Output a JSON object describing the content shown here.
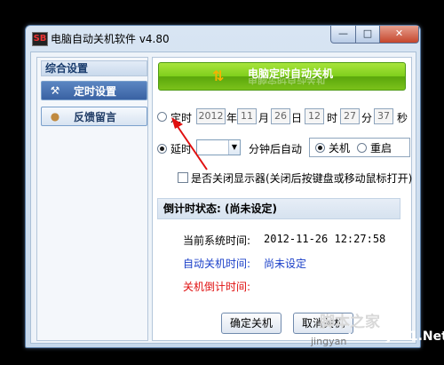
{
  "window": {
    "title": "电脑自动关机软件 v4.80",
    "app_icon_text": "SB",
    "controls": {
      "minimize": "—",
      "maximize": "□",
      "close": "✕"
    }
  },
  "sidebar": {
    "header": "综合设置",
    "items": [
      {
        "label": "定时设置",
        "icon": "tools-icon",
        "active": true
      },
      {
        "label": "反馈留言",
        "icon": "user-icon",
        "active": false
      }
    ]
  },
  "banner": {
    "title": "电脑定时自动关机",
    "icon": "arrows-icon"
  },
  "timed": {
    "label": "定时",
    "year": "2012",
    "year_unit": "年",
    "month": "11",
    "month_unit": "月",
    "day": "26",
    "day_unit": "日",
    "hour": "12",
    "hour_unit": "时",
    "minute": "27",
    "minute_unit": "分",
    "second": "37",
    "second_unit": "秒",
    "selected": false
  },
  "delay": {
    "label": "延时",
    "value": "",
    "suffix": "分钟后自动",
    "selected": true
  },
  "action": {
    "shutdown_label": "关机",
    "restart_label": "重启",
    "selected": "关机"
  },
  "monitor_option": {
    "label": "是否关闭显示器(关闭后按键盘或移动鼠标打开)",
    "checked": false
  },
  "status": {
    "header": "倒计时状态: (尚未设定)",
    "current_time_label": "当前系统时间:",
    "current_time_value": "2012-11-26 12:27:58",
    "auto_shutdown_label": "自动关机时间:",
    "auto_shutdown_value": "尚未设定",
    "countdown_label": "关机倒计时间:",
    "countdown_value": "",
    "colors": {
      "normal": "#000000",
      "blue": "#1a3fc8",
      "red": "#e01010"
    }
  },
  "buttons": {
    "confirm": "确定关机",
    "cancel": "取消关机"
  },
  "watermark": {
    "site": "脚本之家",
    "url": "www.JB51.Net",
    "jingyan": "jingyan"
  }
}
